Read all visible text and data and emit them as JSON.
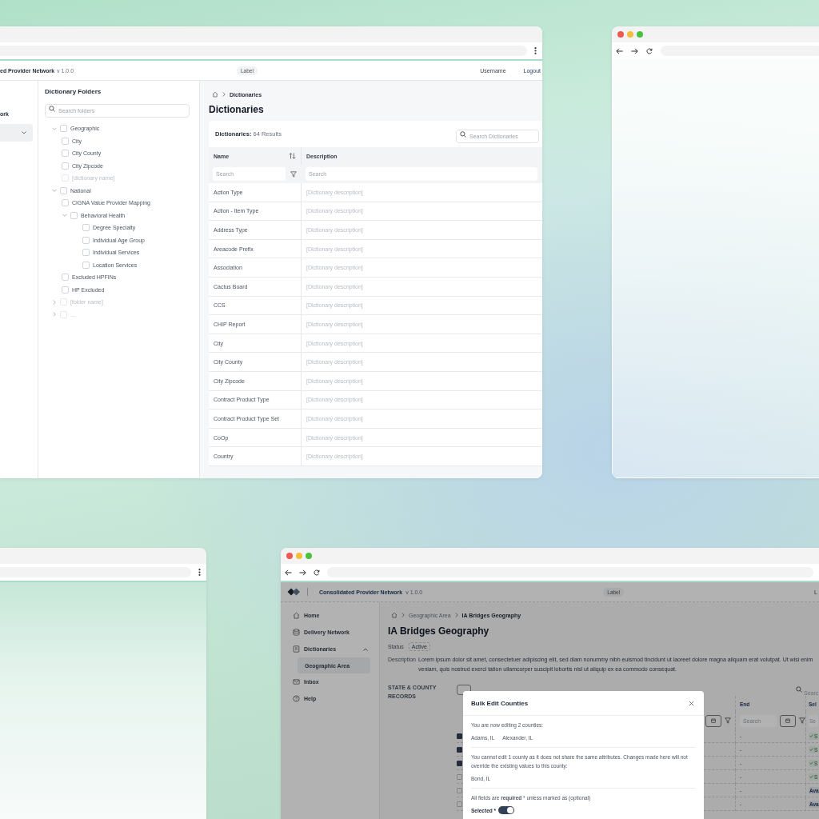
{
  "dictionaries_window": {
    "app_header": {
      "app_name": "ed Provider Network",
      "version": "v 1.0.0",
      "label": "Label",
      "username": "Username",
      "logout": "Logout"
    },
    "sidebar": {
      "items": [
        {
          "label": "ork",
          "selected": false
        },
        {
          "selected": true,
          "expanded": false
        }
      ]
    },
    "folders": {
      "title": "Dictionary Folders",
      "search_placeholder": "Search folders",
      "tree": [
        {
          "label": "Geographic",
          "kind": "folder",
          "expanded": true,
          "checked": false,
          "muted": false,
          "children": [
            {
              "label": "City",
              "kind": "item",
              "checked": false,
              "muted": false
            },
            {
              "label": "City County",
              "kind": "item",
              "checked": false,
              "muted": false
            },
            {
              "label": "City Zipcode",
              "kind": "item",
              "checked": false,
              "muted": false
            },
            {
              "label": "[dictionary name]",
              "kind": "item",
              "checked": false,
              "muted": true
            }
          ]
        },
        {
          "label": "National",
          "kind": "folder",
          "expanded": true,
          "checked": false,
          "muted": false,
          "children": [
            {
              "label": "CIGNA Value Provider Mapping",
              "kind": "item",
              "checked": false,
              "muted": false
            },
            {
              "label": "Behavioral Health",
              "kind": "folder",
              "expanded": true,
              "checked": false,
              "muted": false,
              "children": [
                {
                  "label": "Degree Specialty",
                  "kind": "item",
                  "checked": false,
                  "muted": false
                },
                {
                  "label": "Individual Age Group",
                  "kind": "item",
                  "checked": false,
                  "muted": false
                },
                {
                  "label": "Individual Services",
                  "kind": "item",
                  "checked": false,
                  "muted": false
                },
                {
                  "label": "Location Services",
                  "kind": "item",
                  "checked": false,
                  "muted": false
                }
              ]
            },
            {
              "label": "Excluded HPFINs",
              "kind": "item",
              "checked": false,
              "muted": false
            },
            {
              "label": "HP Excluded",
              "kind": "item",
              "checked": false,
              "muted": false
            }
          ]
        },
        {
          "label": "[folder name]",
          "kind": "folder",
          "expanded": false,
          "checked": false,
          "muted": true
        },
        {
          "label": "...",
          "kind": "folder",
          "expanded": false,
          "checked": false,
          "muted": true
        }
      ]
    },
    "breadcrumb": [
      "Dictionaries"
    ],
    "title": "Dictionaries",
    "table": {
      "label": "Dictionaries:",
      "count": "64 Results",
      "search_placeholder": "Search Dictionaries",
      "columns": [
        {
          "label": "Name",
          "sortable": true,
          "filterable": true,
          "filter_placeholder": "Search"
        },
        {
          "label": "Description",
          "sortable": false,
          "filterable": false,
          "filter_placeholder": "Search"
        }
      ],
      "rows": [
        {
          "name": "Action Type",
          "description": "[Dictionary description]"
        },
        {
          "name": "Action - Item Type",
          "description": "[Dictionary description]"
        },
        {
          "name": "Address Type",
          "description": "[Dictionary description]"
        },
        {
          "name": "Areacode Prefix",
          "description": "[Dictionary description]"
        },
        {
          "name": "Association",
          "description": "[Dictionary description]"
        },
        {
          "name": "Cactus Board",
          "description": "[Dictionary description]"
        },
        {
          "name": "CCS",
          "description": "[Dictionary description]"
        },
        {
          "name": "CHIP Report",
          "description": "[Dictionary description]"
        },
        {
          "name": "City",
          "description": "[Dictionary description]"
        },
        {
          "name": "City County",
          "description": "[Dictionary description]"
        },
        {
          "name": "City Zipcode",
          "description": "[Dictionary description]"
        },
        {
          "name": "Contract Product Type",
          "description": "[Dictionary description]"
        },
        {
          "name": "Contract Product Type Set",
          "description": "[Dictionary description]"
        },
        {
          "name": "CoOp",
          "description": "[Dictionary description]"
        },
        {
          "name": "Country",
          "description": "[Dictionary description]"
        }
      ]
    }
  },
  "geography_window": {
    "app_header": {
      "app_name": "Consolidated Provider Network",
      "version": "v 1.0.0",
      "label": "Label",
      "user": "L"
    },
    "sidebar": {
      "items": [
        {
          "label": "Home",
          "selected": false
        },
        {
          "label": "Delivery Network",
          "selected": false
        },
        {
          "label": "Dictionaries",
          "selected": false,
          "expanded": true,
          "children": [
            {
              "label": "Geographic Area",
              "selected": true
            }
          ]
        },
        {
          "label": "Inbox",
          "selected": false
        },
        {
          "label": "Help",
          "selected": false
        }
      ]
    },
    "breadcrumb": [
      "Geographic Area",
      "IA Bridges Geography"
    ],
    "title": "IA Bridges Geography",
    "status": {
      "label": "Status",
      "value": "Active"
    },
    "description": {
      "label": "Description",
      "lines": [
        "Lorem ipsum dolor sit amet, consectetuer adipiscing elit, sed diam nonummy nibh euismod tincidunt ut laoreet dolore magna aliquam erat volutpat. Ut wisi enim",
        "veniam, quis nostrud exerci tation ullamcorper suscipit lobortis nisl ut aliquip ex ea commodo consequat."
      ]
    },
    "records_label": "STATE & COUNTY RECORDS",
    "table": {
      "search_placeholder": "Searc",
      "columns": [
        {
          "label": "End",
          "filter_placeholder": "Search"
        },
        {
          "label": "Sel",
          "filter_placeholder": "Se"
        }
      ],
      "rows": [
        {
          "checked": true,
          "end": "-",
          "status": "S",
          "kind": "check"
        },
        {
          "checked": true,
          "end": "-",
          "status": "S",
          "kind": "check"
        },
        {
          "checked": true,
          "end": "-",
          "status": "S",
          "kind": "check"
        },
        {
          "checked": false,
          "end": "-",
          "status": "S",
          "kind": "check"
        },
        {
          "checked": false,
          "end": "-",
          "status": "Ava",
          "kind": "plain"
        },
        {
          "checked": false,
          "end": "-",
          "status": "Ava",
          "kind": "plain"
        }
      ]
    },
    "modal": {
      "title": "Bulk Edit Counties",
      "editing_text": "You are now editing 2 counties:",
      "editing_counties": [
        "Adams, IL",
        "Alexander, IL"
      ],
      "warning_text": "You cannot edit 1 county as it does not share the same attributes. Changes made here will not override the existing values to this county:",
      "excluded_counties": [
        "Bond, IL"
      ],
      "required_note": "All fields are **required** * unless marked as (optional)",
      "fields": [
        {
          "label": "Selected *",
          "kind": "toggle",
          "on": true
        }
      ]
    }
  }
}
